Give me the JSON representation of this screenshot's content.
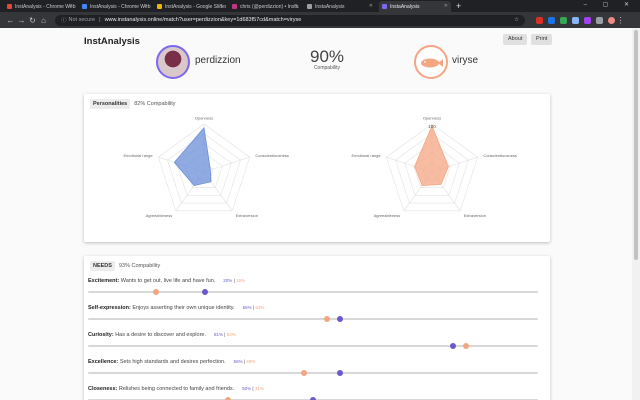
{
  "browser": {
    "tabs": [
      {
        "label": "InstAnalysis - Chrome Web Store",
        "color": "#e8453c",
        "active": false
      },
      {
        "label": "InstAnalysis - Chrome Web Store",
        "color": "#4285f4",
        "active": false
      },
      {
        "label": "InstAnalysis - Google Slides",
        "color": "#f4b400",
        "active": false
      },
      {
        "label": "chris (@perdizzion) • Insta",
        "color": "#c13584",
        "active": false
      },
      {
        "label": "InstaAnalysis",
        "color": "#9aa0a6",
        "active": false
      },
      {
        "label": "InstaAnalysis",
        "color": "#7b68ee",
        "active": true
      }
    ],
    "window_controls": "– ▢ ✕",
    "security_label": "Not secure",
    "url": "www.instanalysis.online/match?user=perdizzion&key=1d683f57cd&match=viryse",
    "new_tab": "+"
  },
  "header": {
    "brand": "InstAnalysis",
    "about_label": "About",
    "print_label": "Print"
  },
  "match": {
    "user_a": "perdizzion",
    "user_b": "viryse",
    "percent": "90%",
    "percent_label": "Compability"
  },
  "personalities": {
    "chip": "Personalities",
    "compat": "82% Compability",
    "axes": [
      "Openness",
      "Conscientiousness",
      "Extraversion",
      "Agreeableness",
      "Emotional range"
    ],
    "scale_max": 100,
    "user_a_values": [
      92,
      14,
      25,
      35,
      65
    ],
    "user_b_values": [
      96,
      36,
      32,
      35,
      38
    ],
    "tick_label": "100",
    "color_a": "#6a8fd8",
    "color_b": "#f4a582"
  },
  "needs": {
    "chip": "NEEDS",
    "compat": "93% Compability",
    "items": [
      {
        "name": "Excitement:",
        "desc": "Wants to get out, live life and have fun.",
        "a": "20%",
        "b": "15%",
        "a_val": 0.26,
        "b_val": 0.15
      },
      {
        "name": "Self-expression:",
        "desc": "Enjoys asserting their own unique identity.",
        "a": "56%",
        "b": "53%",
        "a_val": 0.56,
        "b_val": 0.53
      },
      {
        "name": "Curiosity:",
        "desc": "Has a desire to discover and explore.",
        "a": "81%",
        "b": "84%",
        "a_val": 0.81,
        "b_val": 0.84
      },
      {
        "name": "Excellence:",
        "desc": "Sets high standards and desires perfection.",
        "a": "56%",
        "b": "48%",
        "a_val": 0.56,
        "b_val": 0.48
      },
      {
        "name": "Closeness:",
        "desc": "Relishes being connected to family and friends.",
        "a": "50%",
        "b": "31%",
        "a_val": 0.5,
        "b_val": 0.31
      }
    ]
  }
}
